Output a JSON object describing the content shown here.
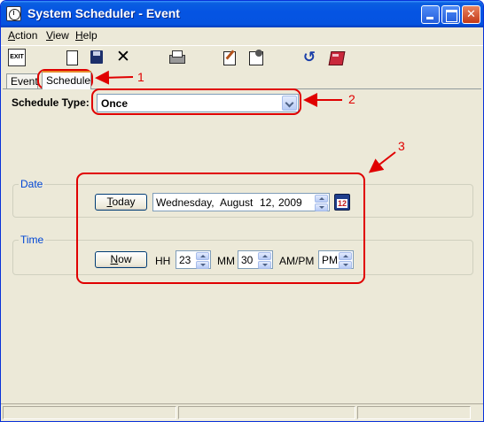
{
  "window": {
    "title": "System Scheduler - Event",
    "controls": {
      "minimize": "minimize",
      "maximize": "maximize",
      "close": "close"
    }
  },
  "menu": {
    "items": [
      {
        "label": "Action",
        "accel": "A"
      },
      {
        "label": "View",
        "accel": "V"
      },
      {
        "label": "Help",
        "accel": "H"
      }
    ]
  },
  "toolbar": {
    "exit_label": "EXIT",
    "icons": [
      "exit-icon",
      "new-document-icon",
      "save-icon",
      "delete-icon",
      "print-icon",
      "edit-icon",
      "properties-icon",
      "refresh-icon",
      "help-book-icon"
    ]
  },
  "tabs": [
    {
      "label": "Event",
      "selected": false
    },
    {
      "label": "Schedule",
      "selected": true
    }
  ],
  "schedule": {
    "type_label": "Schedule Type:",
    "type_value": "Once"
  },
  "date": {
    "group_title": "Date",
    "today_button": "Today",
    "weekday": "Wednesday,",
    "month": "August",
    "day": "12,",
    "year": "2009",
    "calendar_icon_text": "12"
  },
  "time": {
    "group_title": "Time",
    "now_button": "Now",
    "hh_label": "HH",
    "hh_value": "23",
    "mm_label": "MM",
    "mm_value": "30",
    "ampm_label": "AM/PM",
    "ampm_value": "PM"
  },
  "annotations": {
    "labels": [
      "1",
      "2",
      "3"
    ],
    "color": "#e00000"
  },
  "colors": {
    "titlebar": "#0554e3",
    "face": "#ece9d8",
    "groupTitle": "#0046d5"
  }
}
